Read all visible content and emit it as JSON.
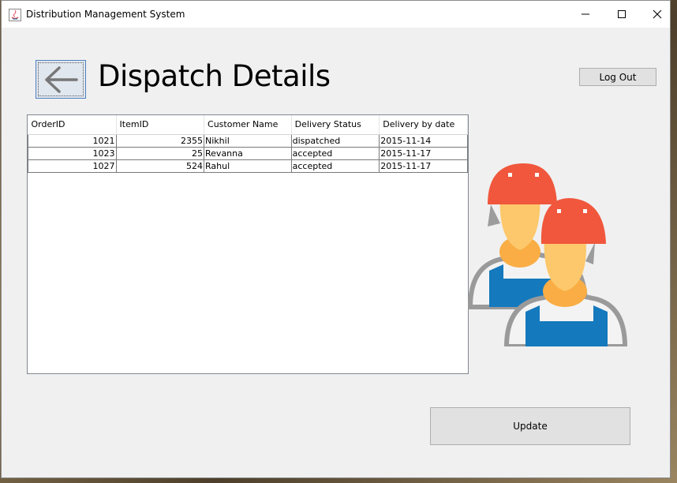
{
  "window": {
    "title": "Distribution Management System"
  },
  "page": {
    "title": "Dispatch Details"
  },
  "buttons": {
    "logout": "Log Out",
    "update": "Update"
  },
  "table": {
    "columns": [
      "OrderID",
      "ItemID",
      "Customer Name",
      "Delivery Status",
      "Delivery by date"
    ],
    "rows": [
      [
        "1021",
        "2355",
        "Nikhil",
        "dispatched",
        "2015-11-14"
      ],
      [
        "1023",
        "25",
        "Revanna",
        "accepted",
        "2015-11-17"
      ],
      [
        "1027",
        "524",
        "Rahul",
        "accepted",
        "2015-11-17"
      ]
    ]
  },
  "icons": {
    "app": "java-app-icon",
    "back": "arrow-left-icon",
    "illustration": "delivery-workers-icon"
  },
  "colors": {
    "cap": "#f0573c",
    "skin": "#fcc86b",
    "overalls": "#1479bd"
  }
}
